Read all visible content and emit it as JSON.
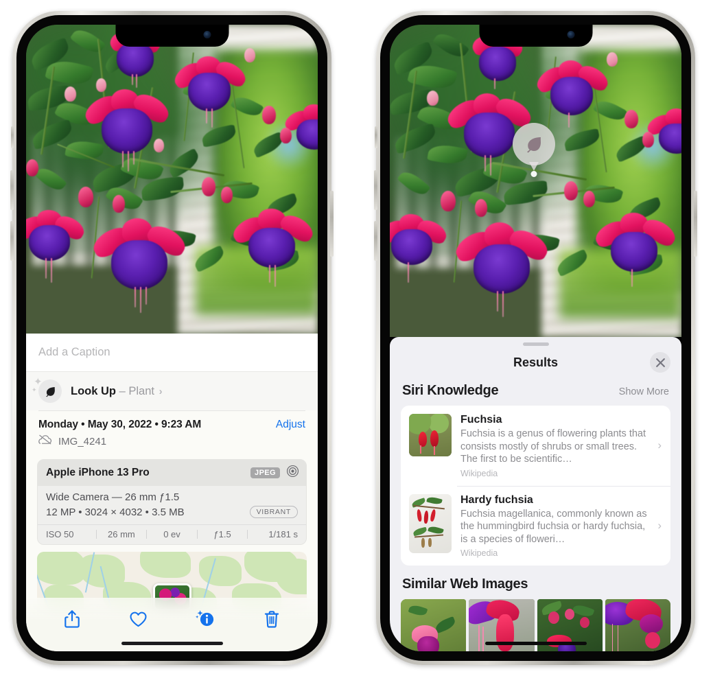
{
  "left_phone": {
    "name": "iphone-photos-info",
    "caption": {
      "placeholder": "Add a Caption",
      "value": ""
    },
    "lookup": {
      "icon": "leaf-icon",
      "label": "Look Up",
      "dash": "–",
      "subject": "Plant",
      "chevron": "›"
    },
    "meta": {
      "date": "Monday • May 30, 2022 • 9:23 AM",
      "adjust_label": "Adjust",
      "cloud_icon": "cloud-slash-icon",
      "filename": "IMG_4241"
    },
    "camera_card": {
      "model": "Apple iPhone 13 Pro",
      "format_tag": "JPEG",
      "raw_icon": "aperture-icon",
      "lens_line": "Wide Camera — 26 mm ƒ1.5",
      "specs_line": "12 MP • 3024 × 4032 • 3.5 MB",
      "style_tag": "VIBRANT",
      "exif": [
        "ISO 50",
        "26 mm",
        "0 ev",
        "ƒ1.5",
        "1/181 s"
      ]
    },
    "toolbar": [
      {
        "name": "share-button",
        "icon": "share-icon"
      },
      {
        "name": "favorite-button",
        "icon": "heart-icon"
      },
      {
        "name": "info-button",
        "icon": "info-sparkle-icon"
      },
      {
        "name": "delete-button",
        "icon": "trash-icon"
      }
    ],
    "accent_color": "#1472ec"
  },
  "right_phone": {
    "name": "iphone-visual-lookup-results",
    "pin": {
      "icon": "leaf-icon",
      "label": "Plant"
    },
    "sheet": {
      "title": "Results",
      "close_icon": "close-icon"
    },
    "siri_section": {
      "title": "Siri Knowledge",
      "show_more": "Show More",
      "items": [
        {
          "title": "Fuchsia",
          "description": "Fuchsia is a genus of flowering plants that consists mostly of shrubs or small trees. The first to be scientific…",
          "source": "Wikipedia",
          "chevron": "›"
        },
        {
          "title": "Hardy fuchsia",
          "description": "Fuchsia magellanica, commonly known as the hummingbird fuchsia or hardy fuchsia, is a species of floweri…",
          "source": "Wikipedia",
          "chevron": "›"
        }
      ]
    },
    "web_section": {
      "title": "Similar Web Images",
      "image_count": 4
    }
  }
}
